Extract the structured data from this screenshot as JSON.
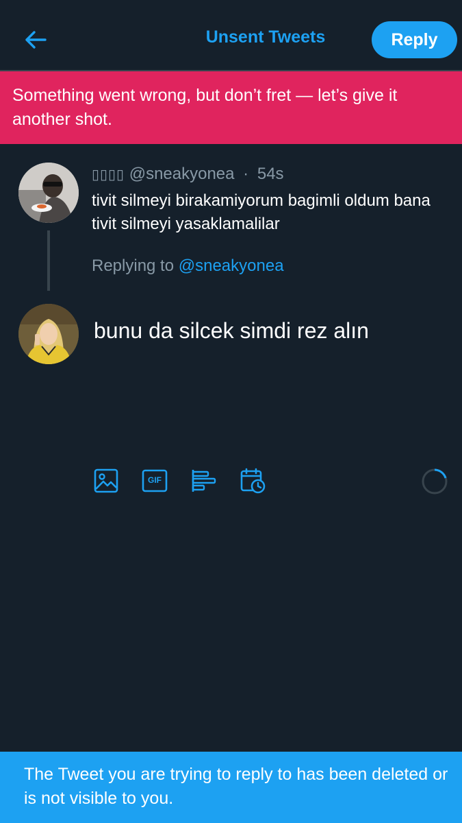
{
  "header": {
    "title": "Unsent Tweets",
    "reply_label": "Reply"
  },
  "error_banner": {
    "message": "Something went wrong, but don’t fret — let’s give it another shot."
  },
  "original_tweet": {
    "display_name": "▯▯▯▯",
    "handle": "@sneakyonea",
    "separator": "·",
    "time": "54s",
    "text": "tivit silmeyi birakamiyorum bagimli oldum bana tivit silmeyi yasaklamalilar"
  },
  "replying": {
    "prefix": "Replying to",
    "handle": "@sneakyonea"
  },
  "compose": {
    "text": "bunu da silcek simdi rez alın"
  },
  "toolbar": {
    "icons": [
      "image-icon",
      "gif-icon",
      "poll-icon",
      "schedule-icon"
    ],
    "gif_label": "GIF"
  },
  "toast": {
    "message": "The Tweet you are trying to reply to has been deleted or is not visible to you."
  },
  "colors": {
    "background": "#15202b",
    "accent": "#1da1f2",
    "error": "#e0245e",
    "muted": "#8899a6",
    "divider": "#38444d"
  }
}
